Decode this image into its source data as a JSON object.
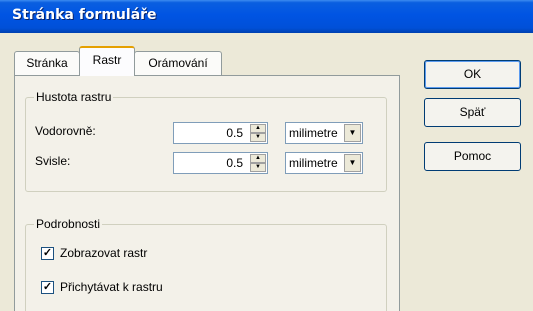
{
  "window": {
    "title": "Stránka formuláře"
  },
  "tabs": [
    {
      "label": "Stránka"
    },
    {
      "label": "Rastr"
    },
    {
      "label": "Orámování"
    }
  ],
  "active_tab": "Rastr",
  "grid_density": {
    "legend": "Hustota rastru",
    "horizontal": {
      "label": "Vodorovně:",
      "value": "0.5",
      "unit": "milimetre"
    },
    "vertical": {
      "label": "Svisle:",
      "value": "0.5",
      "unit": "milimetre"
    }
  },
  "details": {
    "legend": "Podrobnosti",
    "show_grid": {
      "label": "Zobrazovat rastr",
      "checked": true,
      "mark": "✓"
    },
    "snap_to_grid": {
      "label": "Přichytávat k rastru",
      "checked": true,
      "mark": "✓"
    }
  },
  "buttons": {
    "ok": "OK",
    "back": "Späť",
    "help": "Pomoc"
  },
  "icons": {
    "spin_up": "▲",
    "spin_down": "▼",
    "dropdown": "▼"
  }
}
